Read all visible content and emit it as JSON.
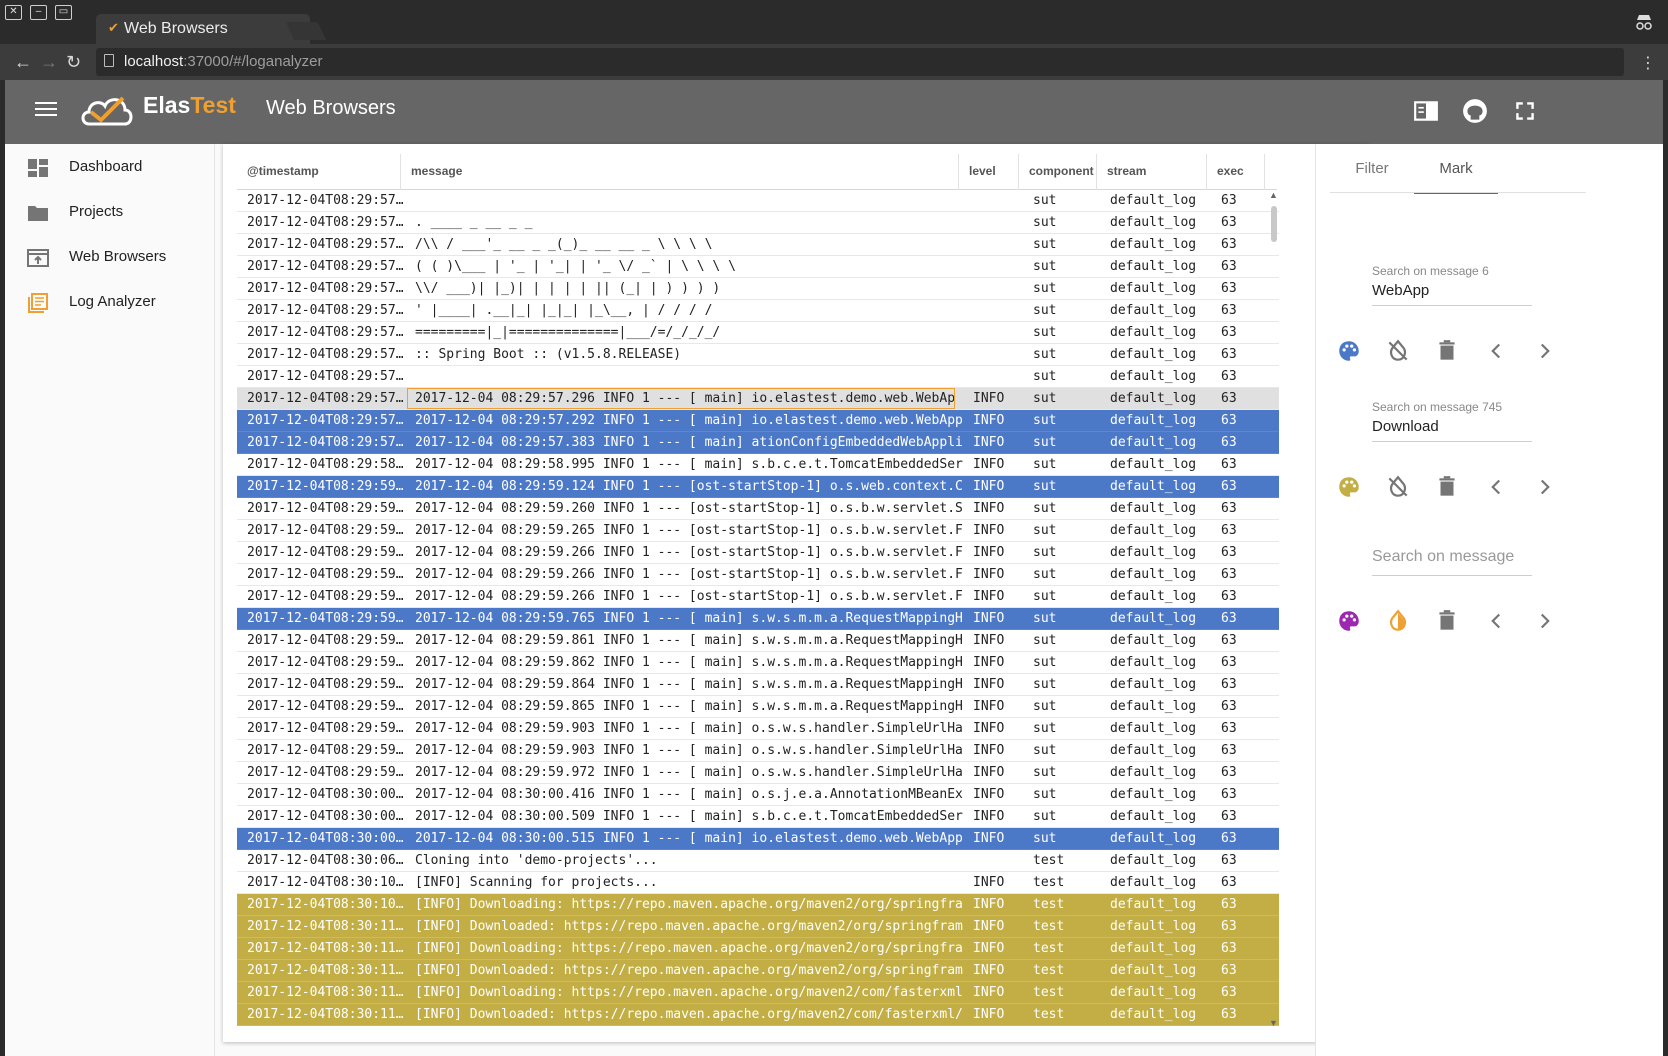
{
  "browser": {
    "tab_title": "Web Browsers",
    "tab_close": "×",
    "url_host": "localhost",
    "url_path": ":37000/#/loganalyzer"
  },
  "app": {
    "logo_part1": "Elas",
    "logo_part2": "Test",
    "page_title": "Web Browsers"
  },
  "sidebar": {
    "items": [
      {
        "label": "Dashboard",
        "icon": "dashboard-icon"
      },
      {
        "label": "Projects",
        "icon": "folder-icon"
      },
      {
        "label": "Web Browsers",
        "icon": "web-browsers-icon"
      },
      {
        "label": "Log Analyzer",
        "icon": "log-analyzer-icon"
      }
    ]
  },
  "grid": {
    "columns": [
      "@timestamp",
      "message",
      "level",
      "component",
      "stream",
      "exec"
    ],
    "rows": [
      {
        "ts": "2017-12-04T08:29:57…",
        "msg": "",
        "lvl": "",
        "comp": "sut",
        "stream": "default_log",
        "exec": "63",
        "state": ""
      },
      {
        "ts": "2017-12-04T08:29:57…",
        "msg": ". ____ _ __ _ _",
        "lvl": "",
        "comp": "sut",
        "stream": "default_log",
        "exec": "63",
        "state": ""
      },
      {
        "ts": "2017-12-04T08:29:57…",
        "msg": "/\\\\ / ___'_ __ _ _(_)_ __ __ _ \\ \\ \\ \\",
        "lvl": "",
        "comp": "sut",
        "stream": "default_log",
        "exec": "63",
        "state": ""
      },
      {
        "ts": "2017-12-04T08:29:57…",
        "msg": "( ( )\\___ | '_ | '_| | '_ \\/ _` | \\ \\ \\ \\",
        "lvl": "",
        "comp": "sut",
        "stream": "default_log",
        "exec": "63",
        "state": ""
      },
      {
        "ts": "2017-12-04T08:29:57…",
        "msg": "\\\\/ ___)| |_)| | | | | || (_| | ) ) ) )",
        "lvl": "",
        "comp": "sut",
        "stream": "default_log",
        "exec": "63",
        "state": ""
      },
      {
        "ts": "2017-12-04T08:29:57…",
        "msg": "' |____| .__|_| |_|_| |_\\__, | / / / /",
        "lvl": "",
        "comp": "sut",
        "stream": "default_log",
        "exec": "63",
        "state": ""
      },
      {
        "ts": "2017-12-04T08:29:57…",
        "msg": "=========|_|==============|___/=/_/_/_/",
        "lvl": "",
        "comp": "sut",
        "stream": "default_log",
        "exec": "63",
        "state": ""
      },
      {
        "ts": "2017-12-04T08:29:57…",
        "msg": ":: Spring Boot :: (v1.5.8.RELEASE)",
        "lvl": "",
        "comp": "sut",
        "stream": "default_log",
        "exec": "63",
        "state": ""
      },
      {
        "ts": "2017-12-04T08:29:57…",
        "msg": "",
        "lvl": "",
        "comp": "sut",
        "stream": "default_log",
        "exec": "63",
        "state": ""
      },
      {
        "ts": "2017-12-04T08:29:57…",
        "msg": "2017-12-04 08:29:57.296 INFO 1 --- [ main] io.elastest.demo.web.WebApp :…",
        "lvl": "INFO",
        "comp": "sut",
        "stream": "default_log",
        "exec": "63",
        "state": "hover"
      },
      {
        "ts": "2017-12-04T08:29:57…",
        "msg": "2017-12-04 08:29:57.292 INFO 1 --- [ main] io.elastest.demo.web.WebApp :…",
        "lvl": "INFO",
        "comp": "sut",
        "stream": "default_log",
        "exec": "63",
        "state": "sel"
      },
      {
        "ts": "2017-12-04T08:29:57…",
        "msg": "2017-12-04 08:29:57.383 INFO 1 --- [ main] ationConfigEmbeddedWebApplica…",
        "lvl": "INFO",
        "comp": "sut",
        "stream": "default_log",
        "exec": "63",
        "state": "sel"
      },
      {
        "ts": "2017-12-04T08:29:58…",
        "msg": "2017-12-04 08:29:58.995 INFO 1 --- [ main] s.b.c.e.t.TomcatEmbeddedServl…",
        "lvl": "INFO",
        "comp": "sut",
        "stream": "default_log",
        "exec": "63",
        "state": ""
      },
      {
        "ts": "2017-12-04T08:29:59…",
        "msg": "2017-12-04 08:29:59.124 INFO 1 --- [ost-startStop-1] o.s.web.context.Con…",
        "lvl": "INFO",
        "comp": "sut",
        "stream": "default_log",
        "exec": "63",
        "state": "sel"
      },
      {
        "ts": "2017-12-04T08:29:59…",
        "msg": "2017-12-04 08:29:59.260 INFO 1 --- [ost-startStop-1] o.s.b.w.servlet.Ser…",
        "lvl": "INFO",
        "comp": "sut",
        "stream": "default_log",
        "exec": "63",
        "state": ""
      },
      {
        "ts": "2017-12-04T08:29:59…",
        "msg": "2017-12-04 08:29:59.265 INFO 1 --- [ost-startStop-1] o.s.b.w.servlet.Fil…",
        "lvl": "INFO",
        "comp": "sut",
        "stream": "default_log",
        "exec": "63",
        "state": ""
      },
      {
        "ts": "2017-12-04T08:29:59…",
        "msg": "2017-12-04 08:29:59.266 INFO 1 --- [ost-startStop-1] o.s.b.w.servlet.Fil…",
        "lvl": "INFO",
        "comp": "sut",
        "stream": "default_log",
        "exec": "63",
        "state": ""
      },
      {
        "ts": "2017-12-04T08:29:59…",
        "msg": "2017-12-04 08:29:59.266 INFO 1 --- [ost-startStop-1] o.s.b.w.servlet.Fil…",
        "lvl": "INFO",
        "comp": "sut",
        "stream": "default_log",
        "exec": "63",
        "state": ""
      },
      {
        "ts": "2017-12-04T08:29:59…",
        "msg": "2017-12-04 08:29:59.266 INFO 1 --- [ost-startStop-1] o.s.b.w.servlet.Fil…",
        "lvl": "INFO",
        "comp": "sut",
        "stream": "default_log",
        "exec": "63",
        "state": ""
      },
      {
        "ts": "2017-12-04T08:29:59…",
        "msg": "2017-12-04 08:29:59.765 INFO 1 --- [ main] s.w.s.m.m.a.RequestMappingHan…",
        "lvl": "INFO",
        "comp": "sut",
        "stream": "default_log",
        "exec": "63",
        "state": "sel"
      },
      {
        "ts": "2017-12-04T08:29:59…",
        "msg": "2017-12-04 08:29:59.861 INFO 1 --- [ main] s.w.s.m.m.a.RequestMappingHan…",
        "lvl": "INFO",
        "comp": "sut",
        "stream": "default_log",
        "exec": "63",
        "state": ""
      },
      {
        "ts": "2017-12-04T08:29:59…",
        "msg": "2017-12-04 08:29:59.862 INFO 1 --- [ main] s.w.s.m.m.a.RequestMappingHan…",
        "lvl": "INFO",
        "comp": "sut",
        "stream": "default_log",
        "exec": "63",
        "state": ""
      },
      {
        "ts": "2017-12-04T08:29:59…",
        "msg": "2017-12-04 08:29:59.864 INFO 1 --- [ main] s.w.s.m.m.a.RequestMappingHan…",
        "lvl": "INFO",
        "comp": "sut",
        "stream": "default_log",
        "exec": "63",
        "state": ""
      },
      {
        "ts": "2017-12-04T08:29:59…",
        "msg": "2017-12-04 08:29:59.865 INFO 1 --- [ main] s.w.s.m.m.a.RequestMappingHan…",
        "lvl": "INFO",
        "comp": "sut",
        "stream": "default_log",
        "exec": "63",
        "state": ""
      },
      {
        "ts": "2017-12-04T08:29:59…",
        "msg": "2017-12-04 08:29:59.903 INFO 1 --- [ main] o.s.w.s.handler.SimpleUrlHand…",
        "lvl": "INFO",
        "comp": "sut",
        "stream": "default_log",
        "exec": "63",
        "state": ""
      },
      {
        "ts": "2017-12-04T08:29:59…",
        "msg": "2017-12-04 08:29:59.903 INFO 1 --- [ main] o.s.w.s.handler.SimpleUrlHand…",
        "lvl": "INFO",
        "comp": "sut",
        "stream": "default_log",
        "exec": "63",
        "state": ""
      },
      {
        "ts": "2017-12-04T08:29:59…",
        "msg": "2017-12-04 08:29:59.972 INFO 1 --- [ main] o.s.w.s.handler.SimpleUrlHand…",
        "lvl": "INFO",
        "comp": "sut",
        "stream": "default_log",
        "exec": "63",
        "state": ""
      },
      {
        "ts": "2017-12-04T08:30:00…",
        "msg": "2017-12-04 08:30:00.416 INFO 1 --- [ main] o.s.j.e.a.AnnotationMBeanExpo…",
        "lvl": "INFO",
        "comp": "sut",
        "stream": "default_log",
        "exec": "63",
        "state": ""
      },
      {
        "ts": "2017-12-04T08:30:00…",
        "msg": "2017-12-04 08:30:00.509 INFO 1 --- [ main] s.b.c.e.t.TomcatEmbeddedServl…",
        "lvl": "INFO",
        "comp": "sut",
        "stream": "default_log",
        "exec": "63",
        "state": ""
      },
      {
        "ts": "2017-12-04T08:30:00…",
        "msg": "2017-12-04 08:30:00.515 INFO 1 --- [ main] io.elastest.demo.web.WebApp :…",
        "lvl": "INFO",
        "comp": "sut",
        "stream": "default_log",
        "exec": "63",
        "state": "sel"
      },
      {
        "ts": "2017-12-04T08:30:06…",
        "msg": "Cloning into 'demo-projects'...",
        "lvl": "",
        "comp": "test",
        "stream": "default_log",
        "exec": "63",
        "state": ""
      },
      {
        "ts": "2017-12-04T08:30:10…",
        "msg": "[INFO] Scanning for projects...",
        "lvl": "INFO",
        "comp": "test",
        "stream": "default_log",
        "exec": "63",
        "state": ""
      },
      {
        "ts": "2017-12-04T08:30:10…",
        "msg": "[INFO] Downloading: https://repo.maven.apache.org/maven2/org/springframe…",
        "lvl": "INFO",
        "comp": "test",
        "stream": "default_log",
        "exec": "63",
        "state": "gold"
      },
      {
        "ts": "2017-12-04T08:30:11…",
        "msg": "[INFO] Downloaded: https://repo.maven.apache.org/maven2/org/springframew…",
        "lvl": "INFO",
        "comp": "test",
        "stream": "default_log",
        "exec": "63",
        "state": "gold"
      },
      {
        "ts": "2017-12-04T08:30:11…",
        "msg": "[INFO] Downloading: https://repo.maven.apache.org/maven2/org/springframe…",
        "lvl": "INFO",
        "comp": "test",
        "stream": "default_log",
        "exec": "63",
        "state": "gold"
      },
      {
        "ts": "2017-12-04T08:30:11…",
        "msg": "[INFO] Downloaded: https://repo.maven.apache.org/maven2/org/springframew…",
        "lvl": "INFO",
        "comp": "test",
        "stream": "default_log",
        "exec": "63",
        "state": "gold"
      },
      {
        "ts": "2017-12-04T08:30:11…",
        "msg": "[INFO] Downloading: https://repo.maven.apache.org/maven2/com/fasterxml/j…",
        "lvl": "INFO",
        "comp": "test",
        "stream": "default_log",
        "exec": "63",
        "state": "gold"
      },
      {
        "ts": "2017-12-04T08:30:11…",
        "msg": "[INFO] Downloaded: https://repo.maven.apache.org/maven2/com/fasterxml/ja…",
        "lvl": "INFO",
        "comp": "test",
        "stream": "default_log",
        "exec": "63",
        "state": "gold"
      }
    ]
  },
  "right_panel": {
    "tabs": [
      "Filter",
      "Mark"
    ],
    "active_tab": "Mark",
    "marks": [
      {
        "label": "Search on message 6",
        "value": "WebApp",
        "color": "#4c78c8",
        "toggle": "invert-colors-off-icon"
      },
      {
        "label": "Search on message 745",
        "value": "Download",
        "color": "#c2ae45",
        "toggle": "invert-colors-off-icon"
      },
      {
        "label": "",
        "value": "",
        "placeholder": "Search on message",
        "color": "#9c27b0",
        "toggle": "invert-colors-icon"
      }
    ]
  },
  "colors": {
    "toolbar": "#666666",
    "selected_row": "#4c78c8",
    "gold_row": "#c2ae45",
    "accent_orange": "#f0a030"
  }
}
